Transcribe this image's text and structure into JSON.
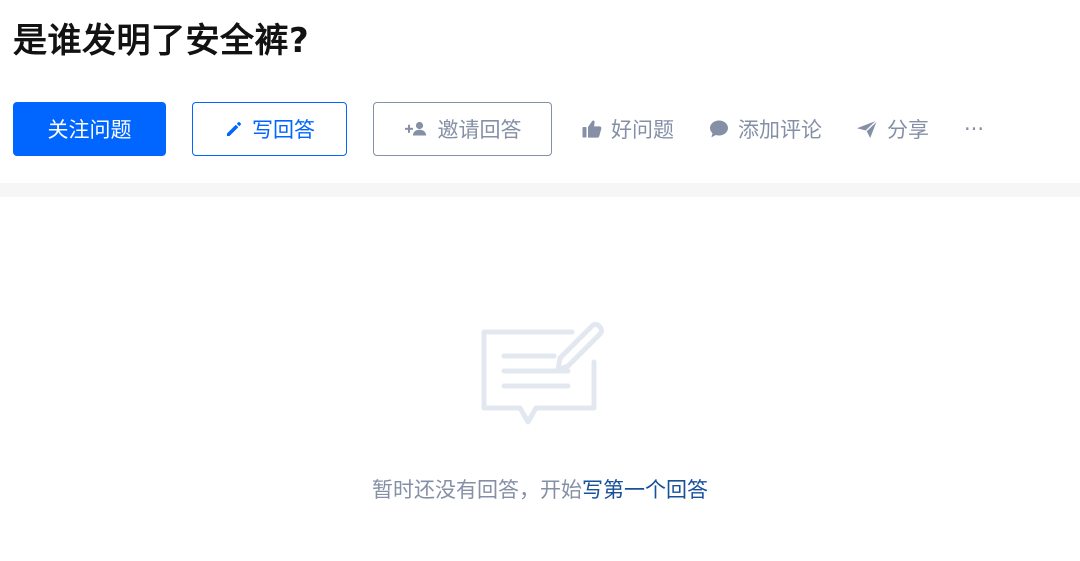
{
  "question": {
    "title": "是谁发明了安全裤?"
  },
  "actions": {
    "follow_label": "关注问题",
    "write_answer_label": "写回答",
    "invite_label": "邀请回答",
    "good_question_label": "好问题",
    "add_comment_label": "添加评论",
    "share_label": "分享",
    "more_label": "···"
  },
  "empty_state": {
    "message": "暂时还没有回答，开始",
    "link_text": "写第一个回答"
  },
  "colors": {
    "primary": "#0066ff",
    "muted": "#8590a6",
    "link": "#175199",
    "title": "#121212",
    "divider": "#f6f6f6"
  },
  "icons": {
    "write": "pencil-icon",
    "invite": "add-person-icon",
    "good_question": "thumbs-up-icon",
    "comment": "comment-bubble-icon",
    "share": "paper-plane-icon",
    "empty": "empty-answer-illustration-icon"
  }
}
